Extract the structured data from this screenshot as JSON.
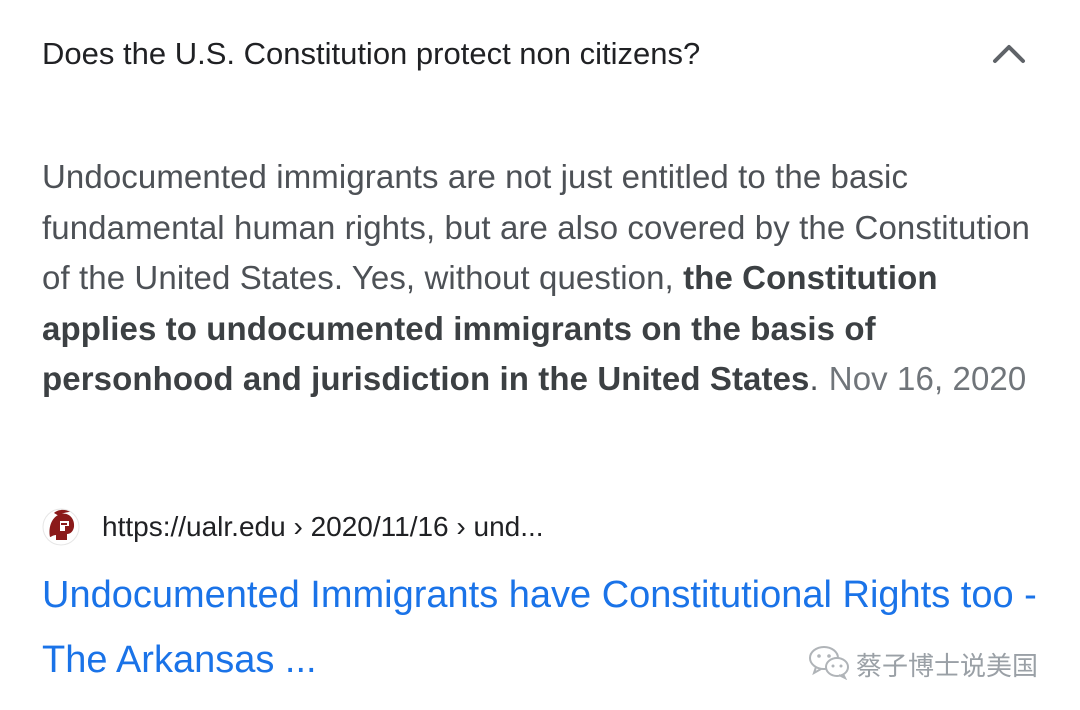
{
  "question": {
    "text": "Does the U.S. Constitution protect non citizens?",
    "toggle_icon": "chevron-up-icon"
  },
  "answer": {
    "intro": "Undocumented immigrants are not just entitled to the basic fundamental human rights, but are also covered by the Constitution of the United States. Yes, without question, ",
    "bold": "the Constitution applies to undocumented immigrants on the basis of personhood and jurisdiction in the United States",
    "end": ".",
    "date": "Nov 16, 2020"
  },
  "source": {
    "favicon_icon": "trojan-helmet-icon",
    "url": "https://ualr.edu › 2020/11/16 › und..."
  },
  "result": {
    "title": "Undocumented Immigrants have Constitutional Rights too - The Arkansas ..."
  },
  "watermark": {
    "icon": "wechat-icon",
    "text": "蔡子博士说美国"
  },
  "colors": {
    "link": "#1a73e8",
    "text": "#4d5156",
    "favicon": "#8b1a1a"
  }
}
